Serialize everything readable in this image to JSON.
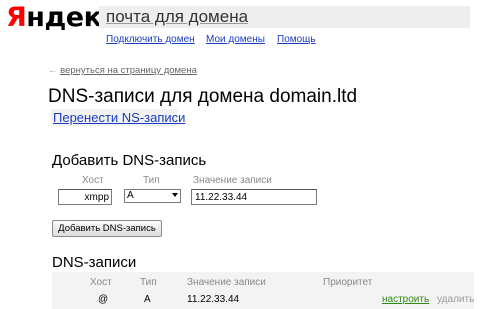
{
  "header": {
    "logo_first_letter": "Я",
    "logo_rest": "ндекс",
    "service_title": "почта для домена",
    "nav": [
      "Подключить домен",
      "Мои домены",
      "Помощь"
    ]
  },
  "back_link": {
    "arrow": "←",
    "label": "вернуться на страницу домена"
  },
  "page_title": "DNS-записи для домена domain.ltd",
  "ns_link": "Перенести NS-записи",
  "add_form": {
    "title": "Добавить DNS-запись",
    "host_label": "Хост",
    "type_label": "Тип",
    "value_label": "Значение записи",
    "host_value": "xmpp",
    "type_value": "A",
    "record_value": "11.22.33.44",
    "submit_label": "Добавить DNS-запись"
  },
  "records": {
    "title": "DNS-записи",
    "columns": [
      "Хост",
      "Тип",
      "Значение записи",
      "Приоритет"
    ],
    "rows": [
      {
        "host": "@",
        "type": "A",
        "value": "11.22.33.44",
        "priority": "",
        "edit": "настроить",
        "delete": "удалить"
      }
    ]
  },
  "colors": {
    "logo_red": "#ff0000",
    "link_blue": "#1a3dc1",
    "edit_green": "#2f8a15",
    "muted_gray": "#999999"
  }
}
